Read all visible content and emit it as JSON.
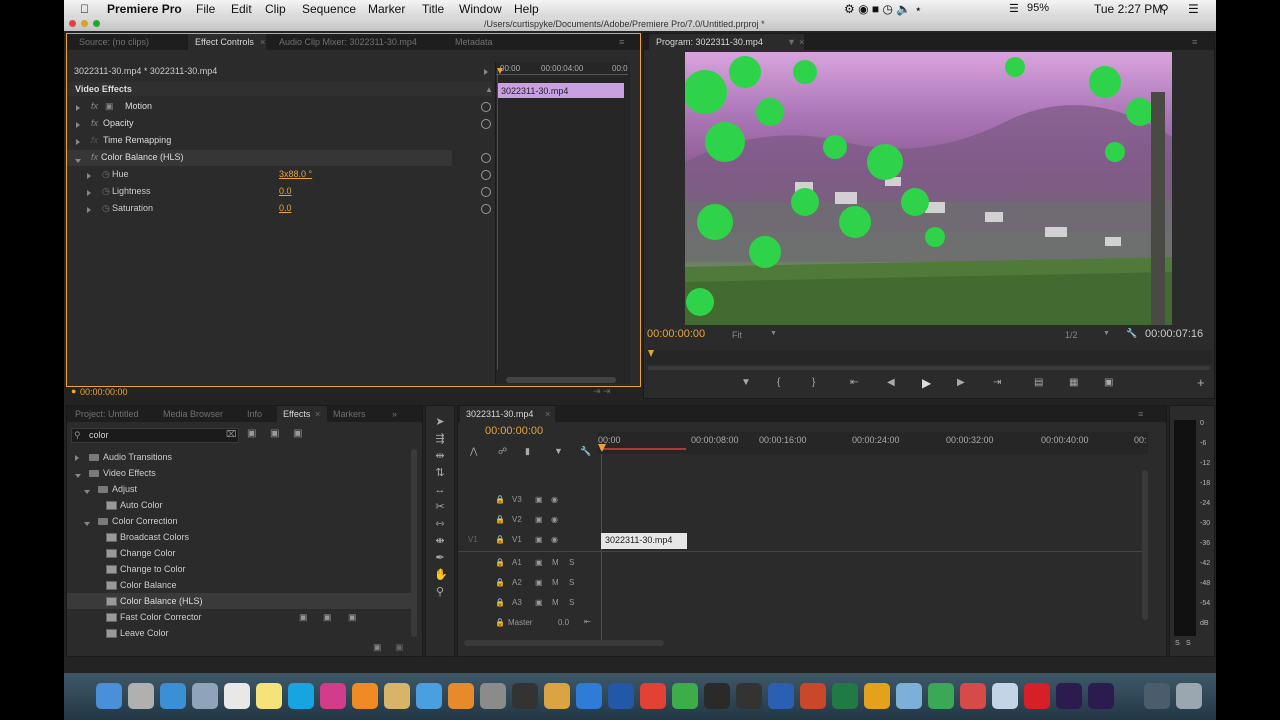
{
  "menubar": {
    "app_name": "Premiere Pro",
    "items": [
      "File",
      "Edit",
      "Clip",
      "Sequence",
      "Marker",
      "Title",
      "Window",
      "Help"
    ],
    "battery": "95%",
    "clock": "Tue 2:27 PM"
  },
  "titlebar": {
    "path": "/Users/curtispyke/Documents/Adobe/Premiere Pro/7.0/Untitled.prproj *"
  },
  "source_panel": {
    "tabs": [
      "Source: (no clips)",
      "Effect Controls",
      "Audio Clip Mixer: 3022311-30.mp4",
      "Metadata"
    ],
    "active_tab": "Effect Controls",
    "clip_path": "3022311-30.mp4 * 3022311-30.mp4",
    "ruler": [
      "00:00",
      "00:00:04:00",
      "00:0"
    ],
    "clip_label": "3022311-30.mp4",
    "section": "Video Effects",
    "effects": [
      "Motion",
      "Opacity",
      "Time Remapping",
      "Color Balance (HLS)"
    ],
    "params": [
      {
        "name": "Hue",
        "value": "3x88.0 °"
      },
      {
        "name": "Lightness",
        "value": "0.0"
      },
      {
        "name": "Saturation",
        "value": "0.0"
      }
    ],
    "timecode": "00:00:00:00"
  },
  "program_panel": {
    "tab": "Program: 3022311-30.mp4",
    "timecode_left": "00:00:00:00",
    "fit": "Fit",
    "resolution": "1/2",
    "timecode_right": "00:00:07:16"
  },
  "project_panel": {
    "tabs": [
      "Project: Untitled",
      "Media Browser",
      "Info",
      "Effects",
      "Markers"
    ],
    "active_tab": "Effects",
    "search_value": "color",
    "tree": [
      {
        "label": "Audio Transitions",
        "level": 0,
        "type": "folder"
      },
      {
        "label": "Video Effects",
        "level": 0,
        "type": "folder"
      },
      {
        "label": "Adjust",
        "level": 1,
        "type": "folder"
      },
      {
        "label": "Auto Color",
        "level": 2,
        "type": "effect"
      },
      {
        "label": "Color Correction",
        "level": 1,
        "type": "folder"
      },
      {
        "label": "Broadcast Colors",
        "level": 2,
        "type": "effect"
      },
      {
        "label": "Change Color",
        "level": 2,
        "type": "effect"
      },
      {
        "label": "Change to Color",
        "level": 2,
        "type": "effect"
      },
      {
        "label": "Color Balance",
        "level": 2,
        "type": "effect"
      },
      {
        "label": "Color Balance (HLS)",
        "level": 2,
        "type": "effect"
      },
      {
        "label": "Fast Color Corrector",
        "level": 2,
        "type": "effect"
      },
      {
        "label": "Leave Color",
        "level": 2,
        "type": "effect"
      }
    ]
  },
  "timeline": {
    "tab": "3022311-30.mp4",
    "timecode": "00:00:00:00",
    "ruler": [
      "00:00",
      "00:00:08:00",
      "00:00:16:00",
      "00:00:24:00",
      "00:00:32:00",
      "00:00:40:00",
      "00:"
    ],
    "video_tracks": [
      "V3",
      "V2",
      "V1"
    ],
    "source_patch": "V1",
    "audio_tracks": [
      "A1",
      "A2",
      "A3"
    ],
    "master_label": "Master",
    "master_value": "0.0",
    "clip_label": "3022311-30.mp4",
    "mute": "M",
    "solo": "S"
  },
  "meters": {
    "labels": [
      "0",
      "-6",
      "-12",
      "-18",
      "-24",
      "-30",
      "-36",
      "-42",
      "-48",
      "-54",
      "dB"
    ],
    "solo": [
      "S",
      "S"
    ]
  }
}
